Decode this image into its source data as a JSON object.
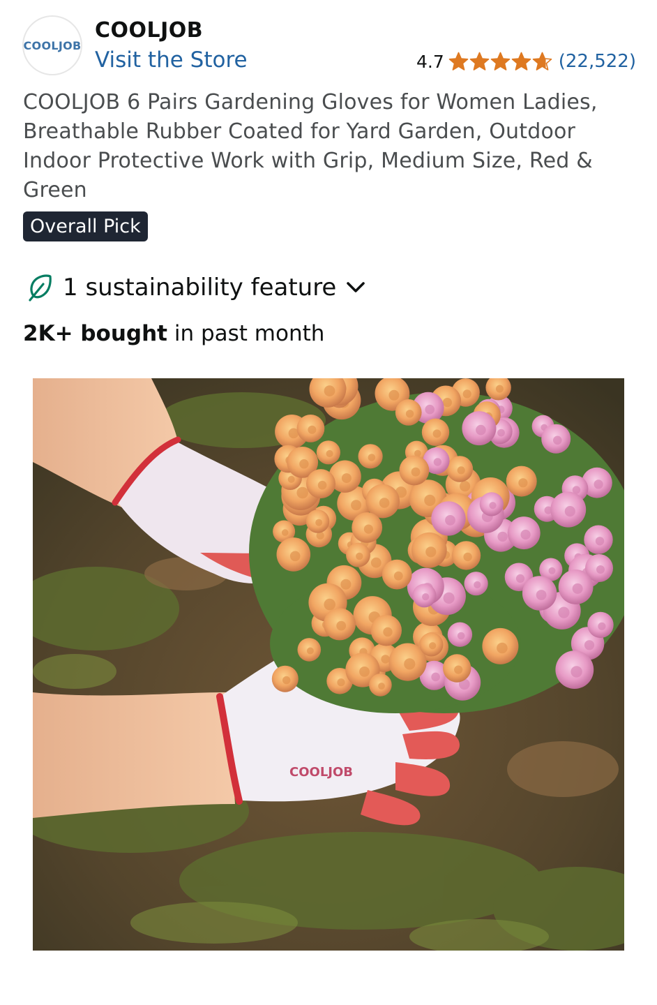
{
  "brand": {
    "logo_text": "COOLJOB",
    "name": "COOLJOB",
    "visit_store": "Visit the Store"
  },
  "rating": {
    "value": "4.7",
    "stars": 4.7,
    "count": "(22,522)",
    "star_color": "#de7921"
  },
  "product": {
    "title": "COOLJOB 6 Pairs Gardening Gloves for Women Ladies, Breathable Rubber Coated for Yard Garden, Outdoor Indoor Protective Work with Grip, Medium Size, Red & Green",
    "badge": "Overall Pick",
    "sustainability": "1 sustainability feature",
    "bought_bold": "2K+ bought",
    "bought_rest": " in past month",
    "image_glove_text": "COOLJOB"
  },
  "colors": {
    "link": "#2162a1",
    "badge_bg": "#1f2633",
    "leaf": "#067d62"
  },
  "icons": {
    "star": "star-icon",
    "leaf": "leaf-icon",
    "chevron": "chevron-down-icon"
  }
}
